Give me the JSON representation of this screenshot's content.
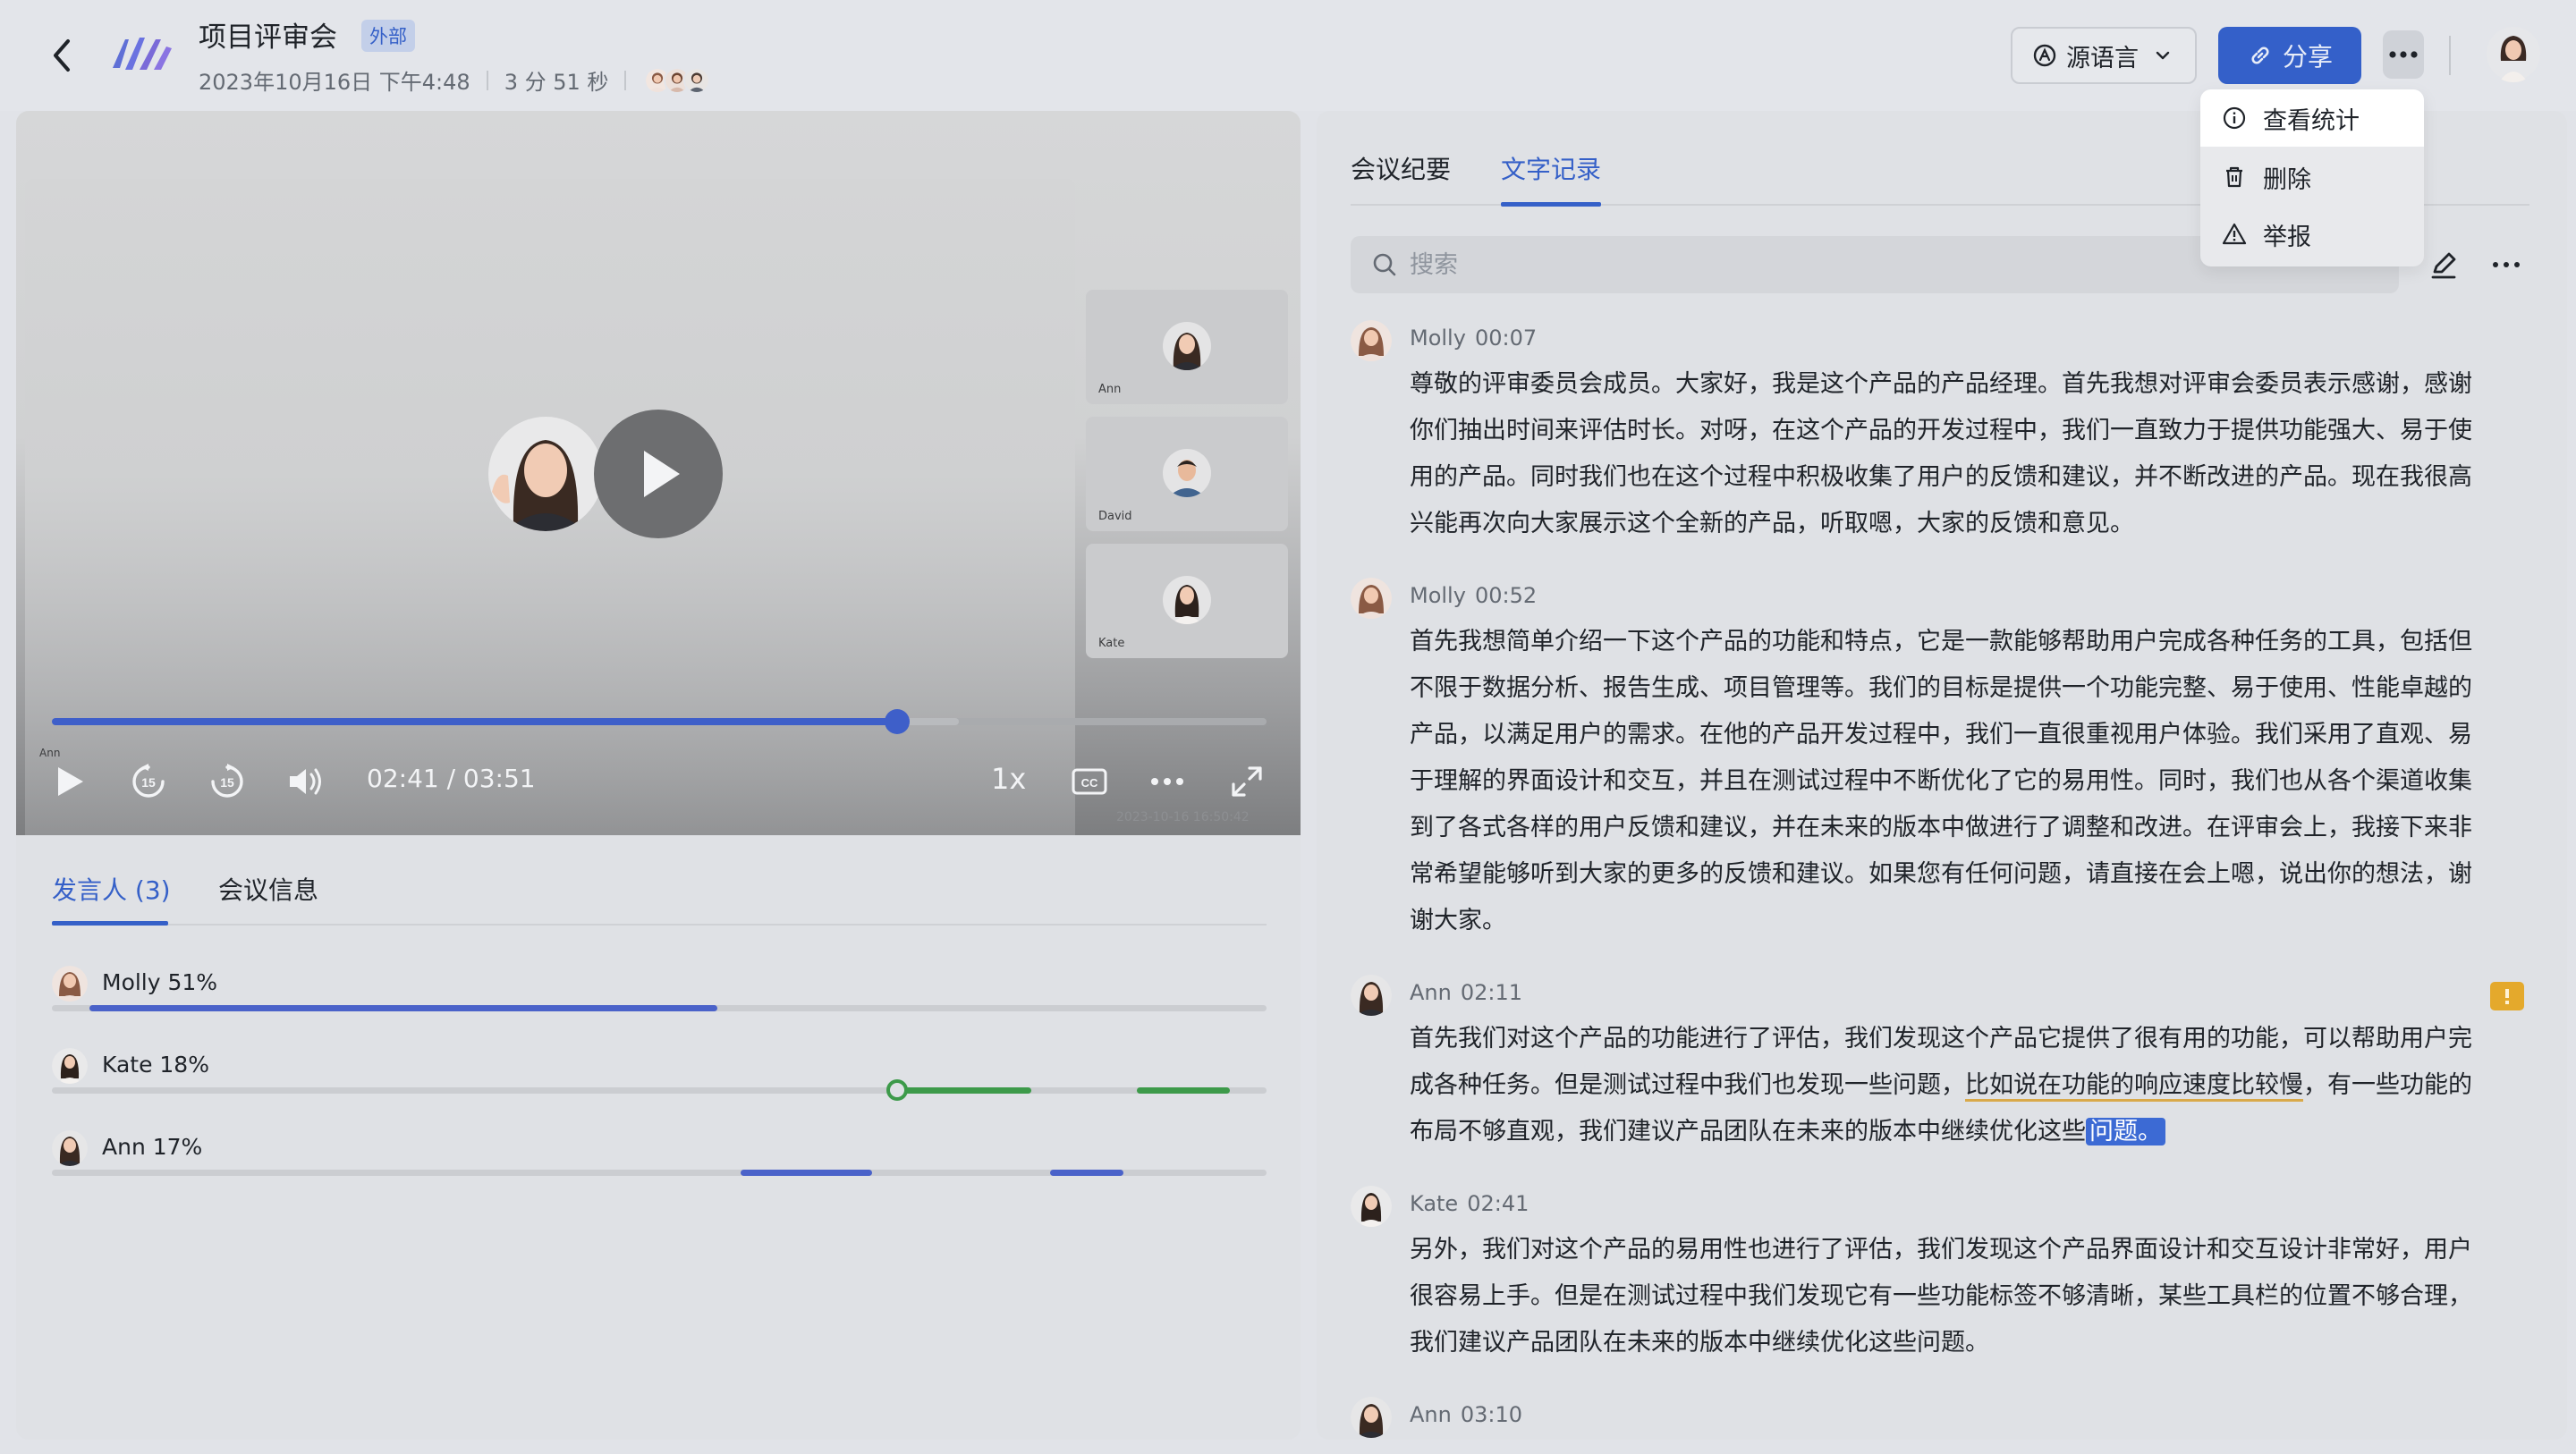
{
  "header": {
    "title": "项目评审会",
    "badge": "外部",
    "date": "2023年10月16日 下午4:48",
    "duration": "3 分 51 秒",
    "language_label": "源语言",
    "share_label": "分享"
  },
  "menu": {
    "items": [
      {
        "label": "查看统计",
        "icon": "info-icon"
      },
      {
        "label": "删除",
        "icon": "trash-icon"
      },
      {
        "label": "举报",
        "icon": "warning-icon"
      }
    ]
  },
  "video": {
    "thumbnails": [
      "Ann",
      "David",
      "Kate"
    ],
    "active_label": "Ann",
    "current_time": "02:41",
    "total_time": "03:51",
    "time_display": "02:41 / 03:51",
    "progress_fraction": 0.696,
    "buffer_fraction": 0.747,
    "speed": "1x",
    "watermark": "2023-10-16 16:50:42"
  },
  "left_tabs": {
    "speakers": "发言人 (3)",
    "meeting_info": "会议信息"
  },
  "speakers": [
    {
      "label": "Molly 51%",
      "segments": [
        [
          0.031,
          0.548
        ]
      ],
      "color": "#4a62c9"
    },
    {
      "label": "Kate 18%",
      "segments": [
        [
          0.696,
          0.806
        ],
        [
          0.893,
          0.97
        ]
      ],
      "color": "#3d9a4a",
      "playing": true
    },
    {
      "label": "Ann 17%",
      "segments": [
        [
          0.567,
          0.675
        ],
        [
          0.822,
          0.882
        ]
      ],
      "color": "#4a62c9"
    }
  ],
  "right_tabs": {
    "minutes": "会议纪要",
    "transcript": "文字记录"
  },
  "search": {
    "placeholder": "搜索"
  },
  "transcript": [
    {
      "speaker": "Molly",
      "time": "00:07",
      "text": "尊敬的评审委员会成员。大家好，我是这个产品的产品经理。首先我想对评审会委员表示感谢，感谢你们抽出时间来评估时长。对呀，在这个产品的开发过程中，我们一直致力于提供功能强大、易于使用的产品。同时我们也在这个过程中积极收集了用户的反馈和建议，并不断改进的产品。现在我很高兴能再次向大家展示这个全新的产品，听取嗯，大家的反馈和意见。"
    },
    {
      "speaker": "Molly",
      "time": "00:52",
      "text": "首先我想简单介绍一下这个产品的功能和特点，它是一款能够帮助用户完成各种任务的工具，包括但不限于数据分析、报告生成、项目管理等。我们的目标是提供一个功能完整、易于使用、性能卓越的产品，以满足用户的需求。在他的产品开发过程中，我们一直很重视用户体验。我们采用了直观、易于理解的界面设计和交互，并且在测试过程中不断优化了它的易用性。同时，我们也从各个渠道收集到了各式各样的用户反馈和建议，并在未来的版本中做进行了调整和改进。在评审会上，我接下来非常希望能够听到大家的更多的反馈和建议。如果您有任何问题，请直接在会上嗯，说出你的想法，谢谢大家。"
    },
    {
      "speaker": "Ann",
      "time": "02:11",
      "text_a": "首先我们对这个产品的功能进行了评估，我们发现这个产品它提供了很有用的功能，可以帮助用户完成各种任务。但是测试过程中我们也发现一些问题，",
      "text_b": "比如说在功能的响应速度比较慢",
      "text_c": "，有一些功能的布局不够直观，我们建议产品团队在未来的版本中继续优化这些",
      "text_d": "问题。"
    },
    {
      "speaker": "Kate",
      "time": "02:41",
      "text": "另外，我们对这个产品的易用性也进行了评估，我们发现这个产品界面设计和交互设计非常好，用户很容易上手。但是在测试过程中我们发现它有一些功能标签不够清晰，某些工具栏的位置不够合理，我们建议产品团队在未来的版本中继续优化这些问题。"
    },
    {
      "speaker": "Ann",
      "time": "03:10",
      "text": ""
    }
  ],
  "colors": {
    "accent": "#3560c8",
    "share_button": "#3460c9",
    "speaker_blue": "#4a62c9",
    "speaker_green": "#3d9a4a",
    "comment": "#e4a92c"
  }
}
